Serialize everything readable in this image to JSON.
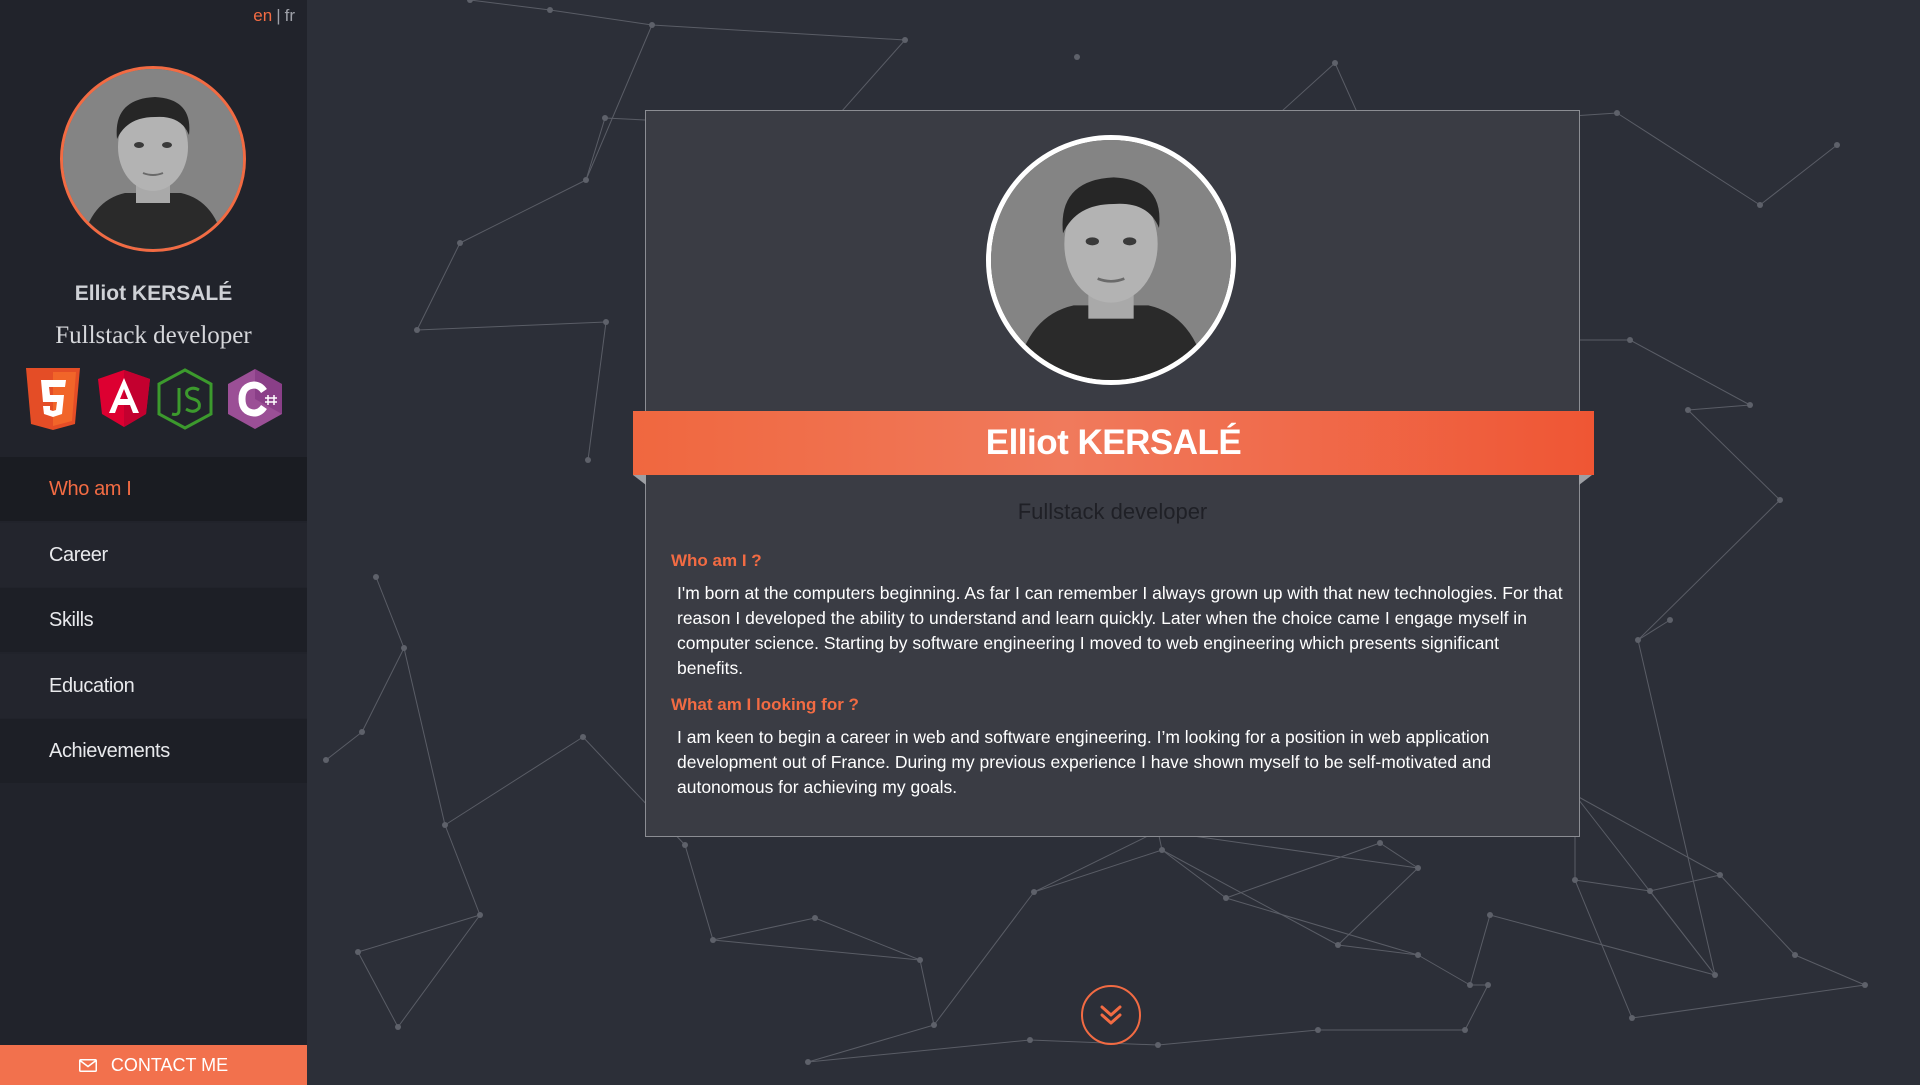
{
  "language_switch": {
    "en": "en",
    "separator": "|",
    "fr": "fr",
    "active": "en"
  },
  "sidebar": {
    "name": "Elliot KERSALÉ",
    "title": "Fullstack developer",
    "tech_icons": [
      "html5-icon",
      "angular-icon",
      "nodejs-icon",
      "csharp-icon"
    ],
    "nav": [
      {
        "label": "Who am I",
        "active": true
      },
      {
        "label": "Career",
        "active": false
      },
      {
        "label": "Skills",
        "active": false
      },
      {
        "label": "Education",
        "active": false
      },
      {
        "label": "Achievements",
        "active": false
      }
    ],
    "contact_label": "CONTACT ME",
    "contact_icon": "envelope-icon"
  },
  "card": {
    "name": "Elliot KERSALÉ",
    "subtitle": "Fullstack developer",
    "sections": [
      {
        "title": "Who am I ?",
        "text": "I'm born at the computers beginning. As far I can remember I always grown up with that new technologies. For that reason I developed the ability to understand and learn quickly. Later when the choice came I engage myself in computer science. Starting by software engineering I moved to web engineering which presents significant benefits."
      },
      {
        "title": "What am I looking for ?",
        "text": "I am keen to begin a career in web and software engineering. I’m looking for a position in web application development out of France. During my previous experience I have shown myself to be self-motivated and autonomous for achieving my goals."
      }
    ]
  },
  "scroll_icon": "double-chevron-down-icon",
  "colors": {
    "accent": "#f26b43",
    "background": "#2c2f38",
    "sidebar": "#21232b",
    "card": "#3a3c44",
    "html5": "#e44d26",
    "angular": "#dd0031",
    "nodejs": "#3c9a2d",
    "csharp": "#9b4f96"
  }
}
